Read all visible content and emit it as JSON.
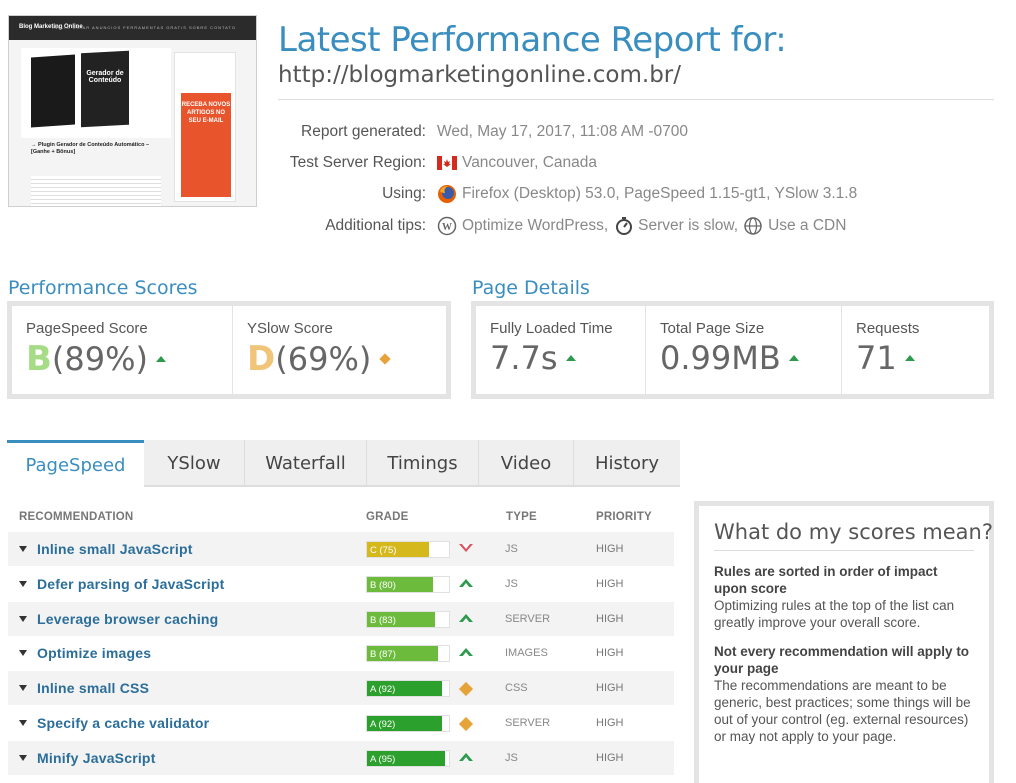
{
  "report": {
    "title": "Latest Performance Report for:",
    "url": "http://blogmarketingonline.com.br/"
  },
  "thumbnail": {
    "site_name": "Blog Marketing Online",
    "nav": "INICIO  CRIAR ANUNCIOS  FERRAMENTAS GRATIS  SOBRE  CONTATO",
    "box_text": "Gerador de Conteúdo",
    "ad_text": "RECEBA NOVOS ARTIGOS NO SEU E-MAIL",
    "post_title": "→ Plugin Gerador de Conteúdo Automático – [Ganhe + Bônus]"
  },
  "meta": {
    "generated_label": "Report generated:",
    "generated_value": "Wed, May 17, 2017, 11:08 AM -0700",
    "region_label": "Test Server Region:",
    "region_value": "Vancouver, Canada",
    "using_label": "Using:",
    "using_value": "Firefox (Desktop) 53.0, PageSpeed 1.15-gt1, YSlow 3.1.8",
    "tips_label": "Additional tips:",
    "tip1": "Optimize WordPress,",
    "tip2": "Server is slow,",
    "tip3": "Use a CDN"
  },
  "performance": {
    "section_title": "Performance Scores",
    "pagespeed_label": "PageSpeed Score",
    "pagespeed_grade": "B",
    "pagespeed_pct": "(89%)",
    "yslow_label": "YSlow Score",
    "yslow_grade": "D",
    "yslow_pct": "(69%)"
  },
  "details": {
    "section_title": "Page Details",
    "loaded_label": "Fully Loaded Time",
    "loaded_value": "7.7s",
    "size_label": "Total Page Size",
    "size_value": "0.99MB",
    "requests_label": "Requests",
    "requests_value": "71"
  },
  "tabs": [
    "PageSpeed",
    "YSlow",
    "Waterfall",
    "Timings",
    "Video",
    "History"
  ],
  "table": {
    "headers": {
      "recommendation": "RECOMMENDATION",
      "grade": "GRADE",
      "type": "TYPE",
      "priority": "PRIORITY"
    },
    "rows": [
      {
        "name": "Inline small JavaScript",
        "grade": "C (75)",
        "score": 75,
        "color": "#d4b81c",
        "trend": "down",
        "type": "JS",
        "priority": "HIGH"
      },
      {
        "name": "Defer parsing of JavaScript",
        "grade": "B (80)",
        "score": 80,
        "color": "#6cbb3c",
        "trend": "up",
        "type": "JS",
        "priority": "HIGH"
      },
      {
        "name": "Leverage browser caching",
        "grade": "B (83)",
        "score": 83,
        "color": "#6cbb3c",
        "trend": "up",
        "type": "SERVER",
        "priority": "HIGH"
      },
      {
        "name": "Optimize images",
        "grade": "B (87)",
        "score": 87,
        "color": "#6cbb3c",
        "trend": "up",
        "type": "IMAGES",
        "priority": "HIGH"
      },
      {
        "name": "Inline small CSS",
        "grade": "A (92)",
        "score": 92,
        "color": "#2ca02c",
        "trend": "neutral",
        "type": "CSS",
        "priority": "HIGH"
      },
      {
        "name": "Specify a cache validator",
        "grade": "A (92)",
        "score": 92,
        "color": "#2ca02c",
        "trend": "neutral",
        "type": "SERVER",
        "priority": "HIGH"
      },
      {
        "name": "Minify JavaScript",
        "grade": "A (95)",
        "score": 95,
        "color": "#2ca02c",
        "trend": "up",
        "type": "JS",
        "priority": "HIGH"
      }
    ]
  },
  "info": {
    "title": "What do my scores mean?",
    "h1": "Rules are sorted in order of impact upon score",
    "p1": "Optimizing rules at the top of the list can greatly improve your overall score.",
    "h2": "Not every recommendation will apply to your page",
    "p2": "The recommendations are meant to be generic, best practices; some things will be out of your control (eg. external resources) or may not apply to your page."
  },
  "colors": {
    "accent": "#3a8ebf",
    "grade_a": "#2ca02c",
    "grade_b": "#6cbb3c",
    "grade_c": "#d4b81c",
    "grade_d": "#e6ae3c",
    "trend_up": "#2e9a4e",
    "trend_down": "#d9535f",
    "trend_neutral": "#e6a33a"
  }
}
